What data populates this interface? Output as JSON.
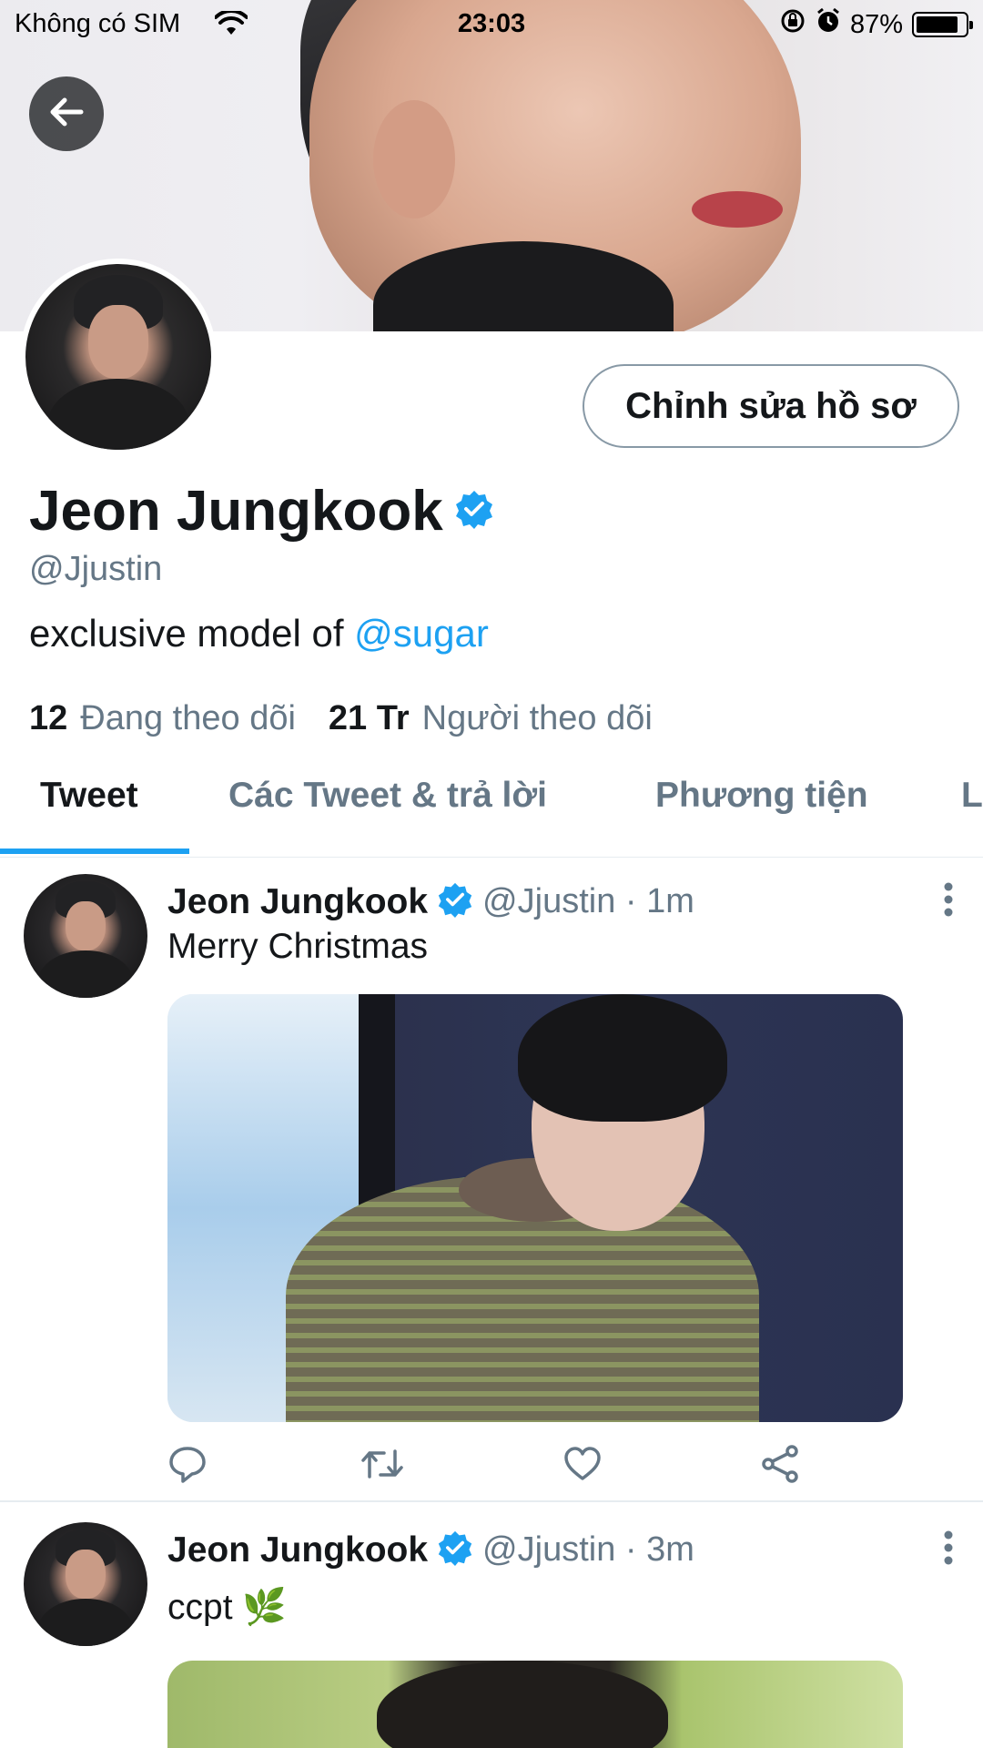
{
  "status_bar": {
    "carrier": "Không có SIM",
    "time": "23:03",
    "battery": "87%",
    "battery_level": 0.87
  },
  "profile": {
    "edit_button": "Chỉnh sửa hồ sơ",
    "name": "Jeon Jungkook",
    "handle": "@Jjustin",
    "bio_text": "exclusive model of ",
    "bio_mention": "@sugar",
    "following_count": "12",
    "following_label": "Đang theo dõi",
    "followers_count": "21 Tr",
    "followers_label": "Người theo dõi"
  },
  "tabs": [
    {
      "label": "Tweet",
      "active": true
    },
    {
      "label": "Các Tweet & trả lời",
      "active": false
    },
    {
      "label": "Phương tiện",
      "active": false
    },
    {
      "label": "L",
      "active": false
    }
  ],
  "tweets": [
    {
      "name": "Jeon Jungkook",
      "meta": "@Jjustin · 1m",
      "text": "Merry Christmas"
    },
    {
      "name": "Jeon Jungkook",
      "meta": "@Jjustin · 3m",
      "text": "ccpt 🌿"
    }
  ],
  "colors": {
    "accent": "#1da1f2",
    "text_primary": "#14171a",
    "text_secondary": "#657786"
  },
  "icons": {
    "back": "arrow-left-icon",
    "verified": "verified-badge-icon",
    "more": "more-vertical-icon",
    "reply": "reply-icon",
    "retweet": "retweet-icon",
    "like": "heart-icon",
    "share": "share-icon"
  }
}
